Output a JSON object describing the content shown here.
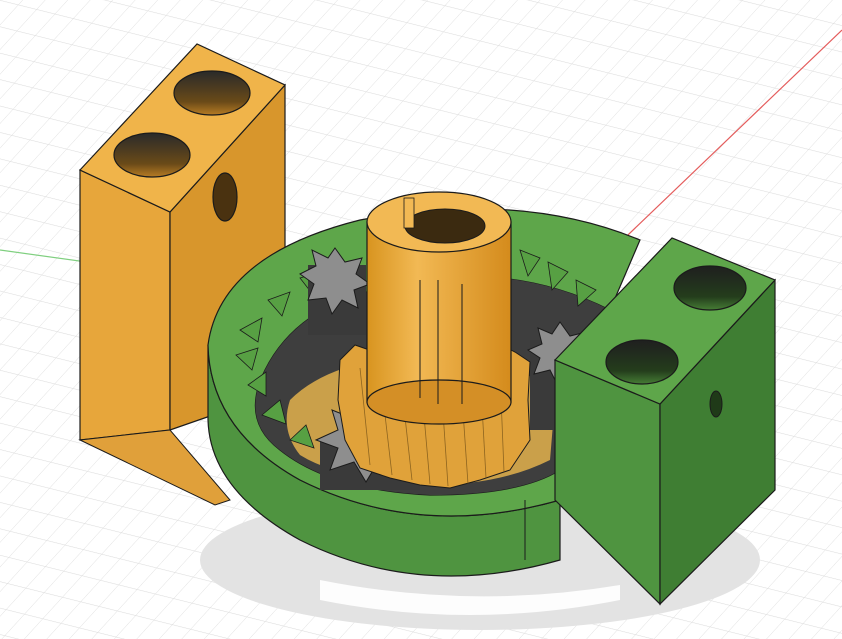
{
  "viewport": {
    "background": "#ffffff",
    "grid_color": "#dcdcdc",
    "axis_x_color": "#e45c5c",
    "axis_y_color": "#7fcf7f"
  },
  "model": {
    "colors": {
      "orange_top": "#f0b44a",
      "orange_front": "#e7a63b",
      "orange_side": "#d38f26",
      "green_top": "#5ea64a",
      "green_front": "#4f9440",
      "green_side": "#3f7e33",
      "gear_gray": "#8e8e8e",
      "gear_dark": "#3a3a3a",
      "shadow": "#e6e6e6",
      "edge": "#1b1b1b"
    }
  }
}
